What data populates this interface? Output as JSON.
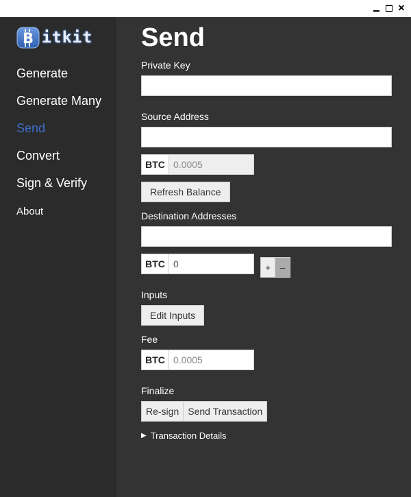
{
  "window": {
    "minimize_icon": "minimize-icon",
    "maximize_icon": "maximize-icon",
    "close_icon": "close-icon",
    "close_glyph": "✕"
  },
  "app": {
    "logo_letter": "B",
    "logo_text": "itkit",
    "brand_color": "#3d6fc7"
  },
  "sidebar": {
    "items": [
      {
        "label": "Generate",
        "active": false
      },
      {
        "label": "Generate Many",
        "active": false
      },
      {
        "label": "Send",
        "active": true
      },
      {
        "label": "Convert",
        "active": false
      },
      {
        "label": "Sign & Verify",
        "active": false
      },
      {
        "label": "About",
        "active": false
      }
    ]
  },
  "main": {
    "title": "Send",
    "private_key": {
      "label": "Private Key",
      "value": ""
    },
    "source_address": {
      "label": "Source Address",
      "value": ""
    },
    "balance": {
      "unit": "BTC",
      "value": "0.0005"
    },
    "refresh_label": "Refresh Balance",
    "destination": {
      "label": "Destination Addresses",
      "value": ""
    },
    "destination_amount": {
      "unit": "BTC",
      "value": "0"
    },
    "plus_label": "+",
    "minus_label": "–",
    "inputs": {
      "label": "Inputs",
      "button": "Edit Inputs"
    },
    "fee": {
      "label": "Fee",
      "unit": "BTC",
      "value": "0.0005"
    },
    "finalize": {
      "label": "Finalize",
      "resign": "Re-sign",
      "send": "Send Transaction"
    },
    "transaction_details": "Transaction Details"
  }
}
